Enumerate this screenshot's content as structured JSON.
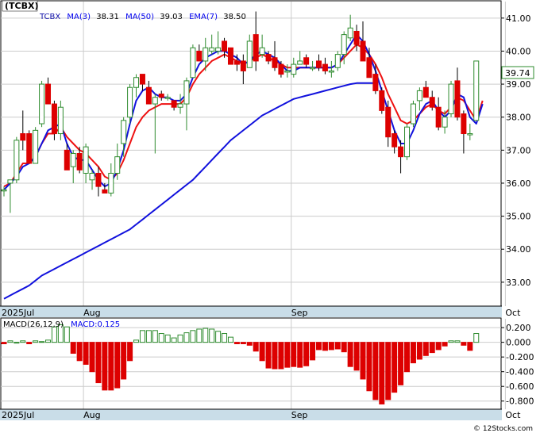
{
  "ticker_label": "(TCBX)",
  "price_legend": [
    {
      "label": "TCBX",
      "value": "",
      "color": "#0000aa"
    },
    {
      "label": "MA(3)",
      "value": "38.31",
      "color": "#0000ee"
    },
    {
      "label": "MA(50)",
      "value": "39.03",
      "color": "#0000ee"
    },
    {
      "label": "EMA(7)",
      "value": "38.50",
      "color": "#0000ee"
    }
  ],
  "last_price": "39.74",
  "macd_legend": [
    {
      "label": "MACD(26,12,9)",
      "value": "",
      "color": "#000000"
    },
    {
      "label": "MACD:",
      "value": "0.125",
      "color": "#0000ee"
    }
  ],
  "footer": "© 12Stocks.com",
  "colors": {
    "up": "#2e8b2e",
    "down": "#dd0000",
    "ma": "#1111dd",
    "ema": "#ee1111",
    "axis_band": "#c9dde8"
  },
  "chart_data": [
    {
      "type": "candlestick",
      "title": "(TCBX)",
      "y_ticks": [
        "33.00",
        "34.00",
        "35.00",
        "36.00",
        "37.00",
        "38.00",
        "39.00",
        "40.00",
        "41.00"
      ],
      "ylim": [
        32.3,
        41.5
      ],
      "x_labels": [
        {
          "label": "2025Jul",
          "index": 0
        },
        {
          "label": "Aug",
          "index": 13
        },
        {
          "label": "Sep",
          "index": 46
        },
        {
          "label": "Oct",
          "index": 80
        }
      ],
      "candles": [
        [
          35.8,
          35.9,
          35.6,
          35.8
        ],
        [
          36.0,
          36.1,
          35.1,
          36.1
        ],
        [
          36.1,
          37.4,
          36.0,
          37.3
        ],
        [
          37.5,
          38.2,
          37.0,
          37.3
        ],
        [
          37.5,
          37.6,
          36.6,
          36.6
        ],
        [
          36.6,
          37.7,
          36.6,
          37.6
        ],
        [
          37.8,
          39.1,
          37.7,
          39.0
        ],
        [
          39.0,
          39.2,
          38.4,
          38.4
        ],
        [
          38.4,
          38.5,
          37.3,
          37.5
        ],
        [
          37.5,
          38.5,
          37.3,
          38.3
        ],
        [
          37.0,
          37.2,
          36.4,
          36.4
        ],
        [
          36.5,
          37.0,
          36.0,
          36.9
        ],
        [
          36.9,
          37.1,
          36.3,
          36.4
        ],
        [
          36.3,
          37.2,
          36.0,
          37.1
        ],
        [
          36.1,
          36.4,
          35.8,
          36.3
        ],
        [
          36.3,
          36.5,
          35.6,
          35.9
        ],
        [
          35.8,
          36.0,
          35.7,
          35.7
        ],
        [
          35.7,
          36.6,
          35.6,
          36.3
        ],
        [
          36.3,
          37.2,
          36.1,
          36.8
        ],
        [
          37.2,
          38.0,
          36.8,
          37.9
        ],
        [
          38.0,
          39.0,
          37.8,
          38.9
        ],
        [
          38.9,
          39.3,
          38.6,
          39.2
        ],
        [
          39.3,
          39.3,
          38.8,
          39.0
        ],
        [
          38.9,
          39.1,
          38.4,
          38.4
        ],
        [
          38.4,
          38.7,
          36.9,
          38.6
        ],
        [
          38.7,
          38.8,
          38.5,
          38.6
        ],
        [
          38.6,
          38.7,
          38.5,
          38.6
        ],
        [
          38.5,
          38.5,
          38.2,
          38.3
        ],
        [
          38.3,
          38.7,
          38.1,
          38.4
        ],
        [
          38.4,
          39.2,
          37.6,
          39.1
        ],
        [
          39.2,
          40.2,
          39.2,
          40.1
        ],
        [
          40.0,
          40.2,
          39.8,
          39.7
        ],
        [
          39.7,
          40.4,
          39.4,
          40.1
        ],
        [
          40.0,
          40.5,
          39.9,
          40.1
        ],
        [
          40.0,
          40.6,
          39.9,
          40.1
        ],
        [
          40.3,
          40.4,
          39.8,
          40.0
        ],
        [
          40.1,
          40.1,
          39.6,
          39.6
        ],
        [
          39.7,
          39.9,
          39.4,
          39.6
        ],
        [
          39.7,
          39.9,
          39.0,
          39.4
        ],
        [
          39.5,
          40.5,
          39.5,
          40.3
        ],
        [
          40.5,
          41.2,
          39.4,
          39.7
        ],
        [
          39.9,
          40.5,
          39.8,
          40.1
        ],
        [
          39.9,
          40.0,
          39.6,
          39.7
        ],
        [
          39.8,
          40.3,
          39.4,
          39.5
        ],
        [
          39.6,
          39.7,
          39.2,
          39.3
        ],
        [
          39.4,
          39.6,
          39.2,
          39.4
        ],
        [
          39.3,
          39.8,
          39.2,
          39.6
        ],
        [
          39.6,
          40.0,
          39.6,
          39.7
        ],
        [
          39.8,
          39.9,
          39.5,
          39.6
        ],
        [
          39.5,
          39.7,
          39.4,
          39.5
        ],
        [
          39.7,
          39.9,
          39.4,
          39.5
        ],
        [
          39.6,
          39.8,
          39.3,
          39.4
        ],
        [
          39.4,
          39.7,
          39.2,
          39.4
        ],
        [
          39.5,
          40.0,
          39.4,
          39.9
        ],
        [
          39.9,
          40.6,
          39.6,
          40.5
        ],
        [
          40.4,
          41.1,
          40.3,
          40.7
        ],
        [
          40.6,
          40.8,
          40.0,
          40.2
        ],
        [
          40.3,
          40.9,
          39.9,
          39.7
        ],
        [
          39.8,
          40.1,
          39.2,
          39.2
        ],
        [
          39.3,
          39.6,
          38.7,
          38.8
        ],
        [
          38.8,
          38.9,
          38.1,
          38.2
        ],
        [
          38.3,
          38.5,
          37.1,
          37.4
        ],
        [
          37.5,
          37.6,
          36.9,
          37.1
        ],
        [
          37.1,
          37.3,
          36.3,
          36.8
        ],
        [
          36.8,
          37.8,
          36.7,
          37.7
        ],
        [
          37.8,
          38.5,
          37.7,
          38.4
        ],
        [
          38.5,
          38.9,
          38.2,
          38.8
        ],
        [
          38.9,
          39.1,
          38.7,
          38.6
        ],
        [
          38.6,
          38.8,
          38.2,
          38.3
        ],
        [
          38.3,
          38.6,
          37.6,
          37.7
        ],
        [
          37.7,
          38.2,
          37.5,
          38.0
        ],
        [
          38.1,
          39.1,
          38.0,
          39.0
        ],
        [
          39.1,
          39.5,
          37.9,
          38.0
        ],
        [
          38.1,
          38.2,
          36.9,
          37.5
        ],
        [
          37.5,
          37.8,
          37.3,
          37.5
        ],
        [
          37.9,
          39.5,
          37.9,
          39.7
        ]
      ],
      "ma3": [
        35.8,
        36.0,
        36.2,
        36.5,
        36.6,
        36.8,
        37.2,
        37.6,
        37.7,
        37.8,
        37.2,
        36.8,
        36.7,
        36.7,
        36.4,
        36.1,
        35.9,
        36.0,
        36.4,
        37.0,
        37.8,
        38.5,
        38.8,
        38.9,
        38.7,
        38.6,
        38.6,
        38.5,
        38.5,
        38.7,
        39.2,
        39.6,
        39.8,
        39.9,
        40.0,
        40.0,
        39.9,
        39.8,
        39.6,
        39.7,
        39.9,
        40.0,
        39.9,
        39.8,
        39.6,
        39.4,
        39.4,
        39.5,
        39.5,
        39.5,
        39.5,
        39.5,
        39.5,
        39.6,
        39.9,
        40.2,
        40.5,
        40.3,
        39.9,
        39.4,
        38.8,
        38.2,
        37.6,
        37.2,
        37.2,
        37.6,
        38.1,
        38.4,
        38.5,
        38.2,
        38.0,
        38.2,
        38.7,
        38.6,
        38.0,
        37.8,
        38.4
      ],
      "ema7": [
        35.9,
        36.0,
        36.3,
        36.6,
        36.6,
        36.8,
        37.2,
        37.5,
        37.5,
        37.7,
        37.4,
        37.2,
        37.0,
        36.9,
        36.7,
        36.5,
        36.2,
        36.1,
        36.3,
        36.7,
        37.2,
        37.7,
        38.0,
        38.2,
        38.3,
        38.4,
        38.4,
        38.4,
        38.4,
        38.6,
        39.0,
        39.3,
        39.5,
        39.7,
        39.8,
        39.9,
        39.8,
        39.7,
        39.6,
        39.7,
        39.8,
        39.9,
        39.8,
        39.7,
        39.6,
        39.5,
        39.5,
        39.5,
        39.5,
        39.5,
        39.5,
        39.5,
        39.5,
        39.6,
        39.8,
        40.0,
        40.2,
        40.1,
        39.9,
        39.6,
        39.2,
        38.7,
        38.3,
        37.9,
        37.8,
        37.9,
        38.1,
        38.3,
        38.4,
        38.2,
        38.1,
        38.3,
        38.6,
        38.5,
        38.2,
        37.9,
        38.5
      ],
      "ma50": [
        32.5,
        32.6,
        32.7,
        32.8,
        32.9,
        33.05,
        33.2,
        33.3,
        33.4,
        33.5,
        33.6,
        33.7,
        33.8,
        33.9,
        34.0,
        34.1,
        34.2,
        34.3,
        34.4,
        34.5,
        34.6,
        34.75,
        34.9,
        35.05,
        35.2,
        35.35,
        35.5,
        35.65,
        35.8,
        35.95,
        36.1,
        36.3,
        36.5,
        36.7,
        36.9,
        37.1,
        37.3,
        37.45,
        37.6,
        37.75,
        37.9,
        38.05,
        38.15,
        38.25,
        38.35,
        38.45,
        38.55,
        38.6,
        38.65,
        38.7,
        38.75,
        38.8,
        38.85,
        38.9,
        38.95,
        39.0,
        39.03,
        39.03,
        39.03,
        39.03
      ]
    },
    {
      "type": "bar",
      "title": "MACD(26,12,9)",
      "y_ticks": [
        "0.200",
        "0.000",
        "-0.200",
        "-0.400",
        "-0.600",
        "-0.800"
      ],
      "ylim": [
        -0.9,
        0.32
      ],
      "values": [
        -0.02,
        0.02,
        0.0,
        0.02,
        -0.02,
        0.02,
        0.01,
        0.03,
        0.21,
        0.24,
        0.21,
        -0.15,
        -0.25,
        -0.3,
        -0.4,
        -0.55,
        -0.65,
        -0.65,
        -0.62,
        -0.5,
        -0.25,
        0.03,
        0.16,
        0.16,
        0.16,
        0.12,
        0.1,
        0.06,
        0.1,
        0.13,
        0.16,
        0.18,
        0.19,
        0.18,
        0.15,
        0.12,
        0.07,
        -0.02,
        -0.02,
        -0.04,
        -0.12,
        -0.25,
        -0.35,
        -0.36,
        -0.36,
        -0.34,
        -0.33,
        -0.34,
        -0.32,
        -0.24,
        -0.1,
        -0.11,
        -0.1,
        -0.09,
        -0.13,
        -0.33,
        -0.38,
        -0.5,
        -0.66,
        -0.78,
        -0.84,
        -0.78,
        -0.68,
        -0.58,
        -0.4,
        -0.28,
        -0.23,
        -0.18,
        -0.14,
        -0.1,
        -0.05,
        0.02,
        0.02,
        -0.04,
        -0.11,
        0.12
      ]
    }
  ]
}
